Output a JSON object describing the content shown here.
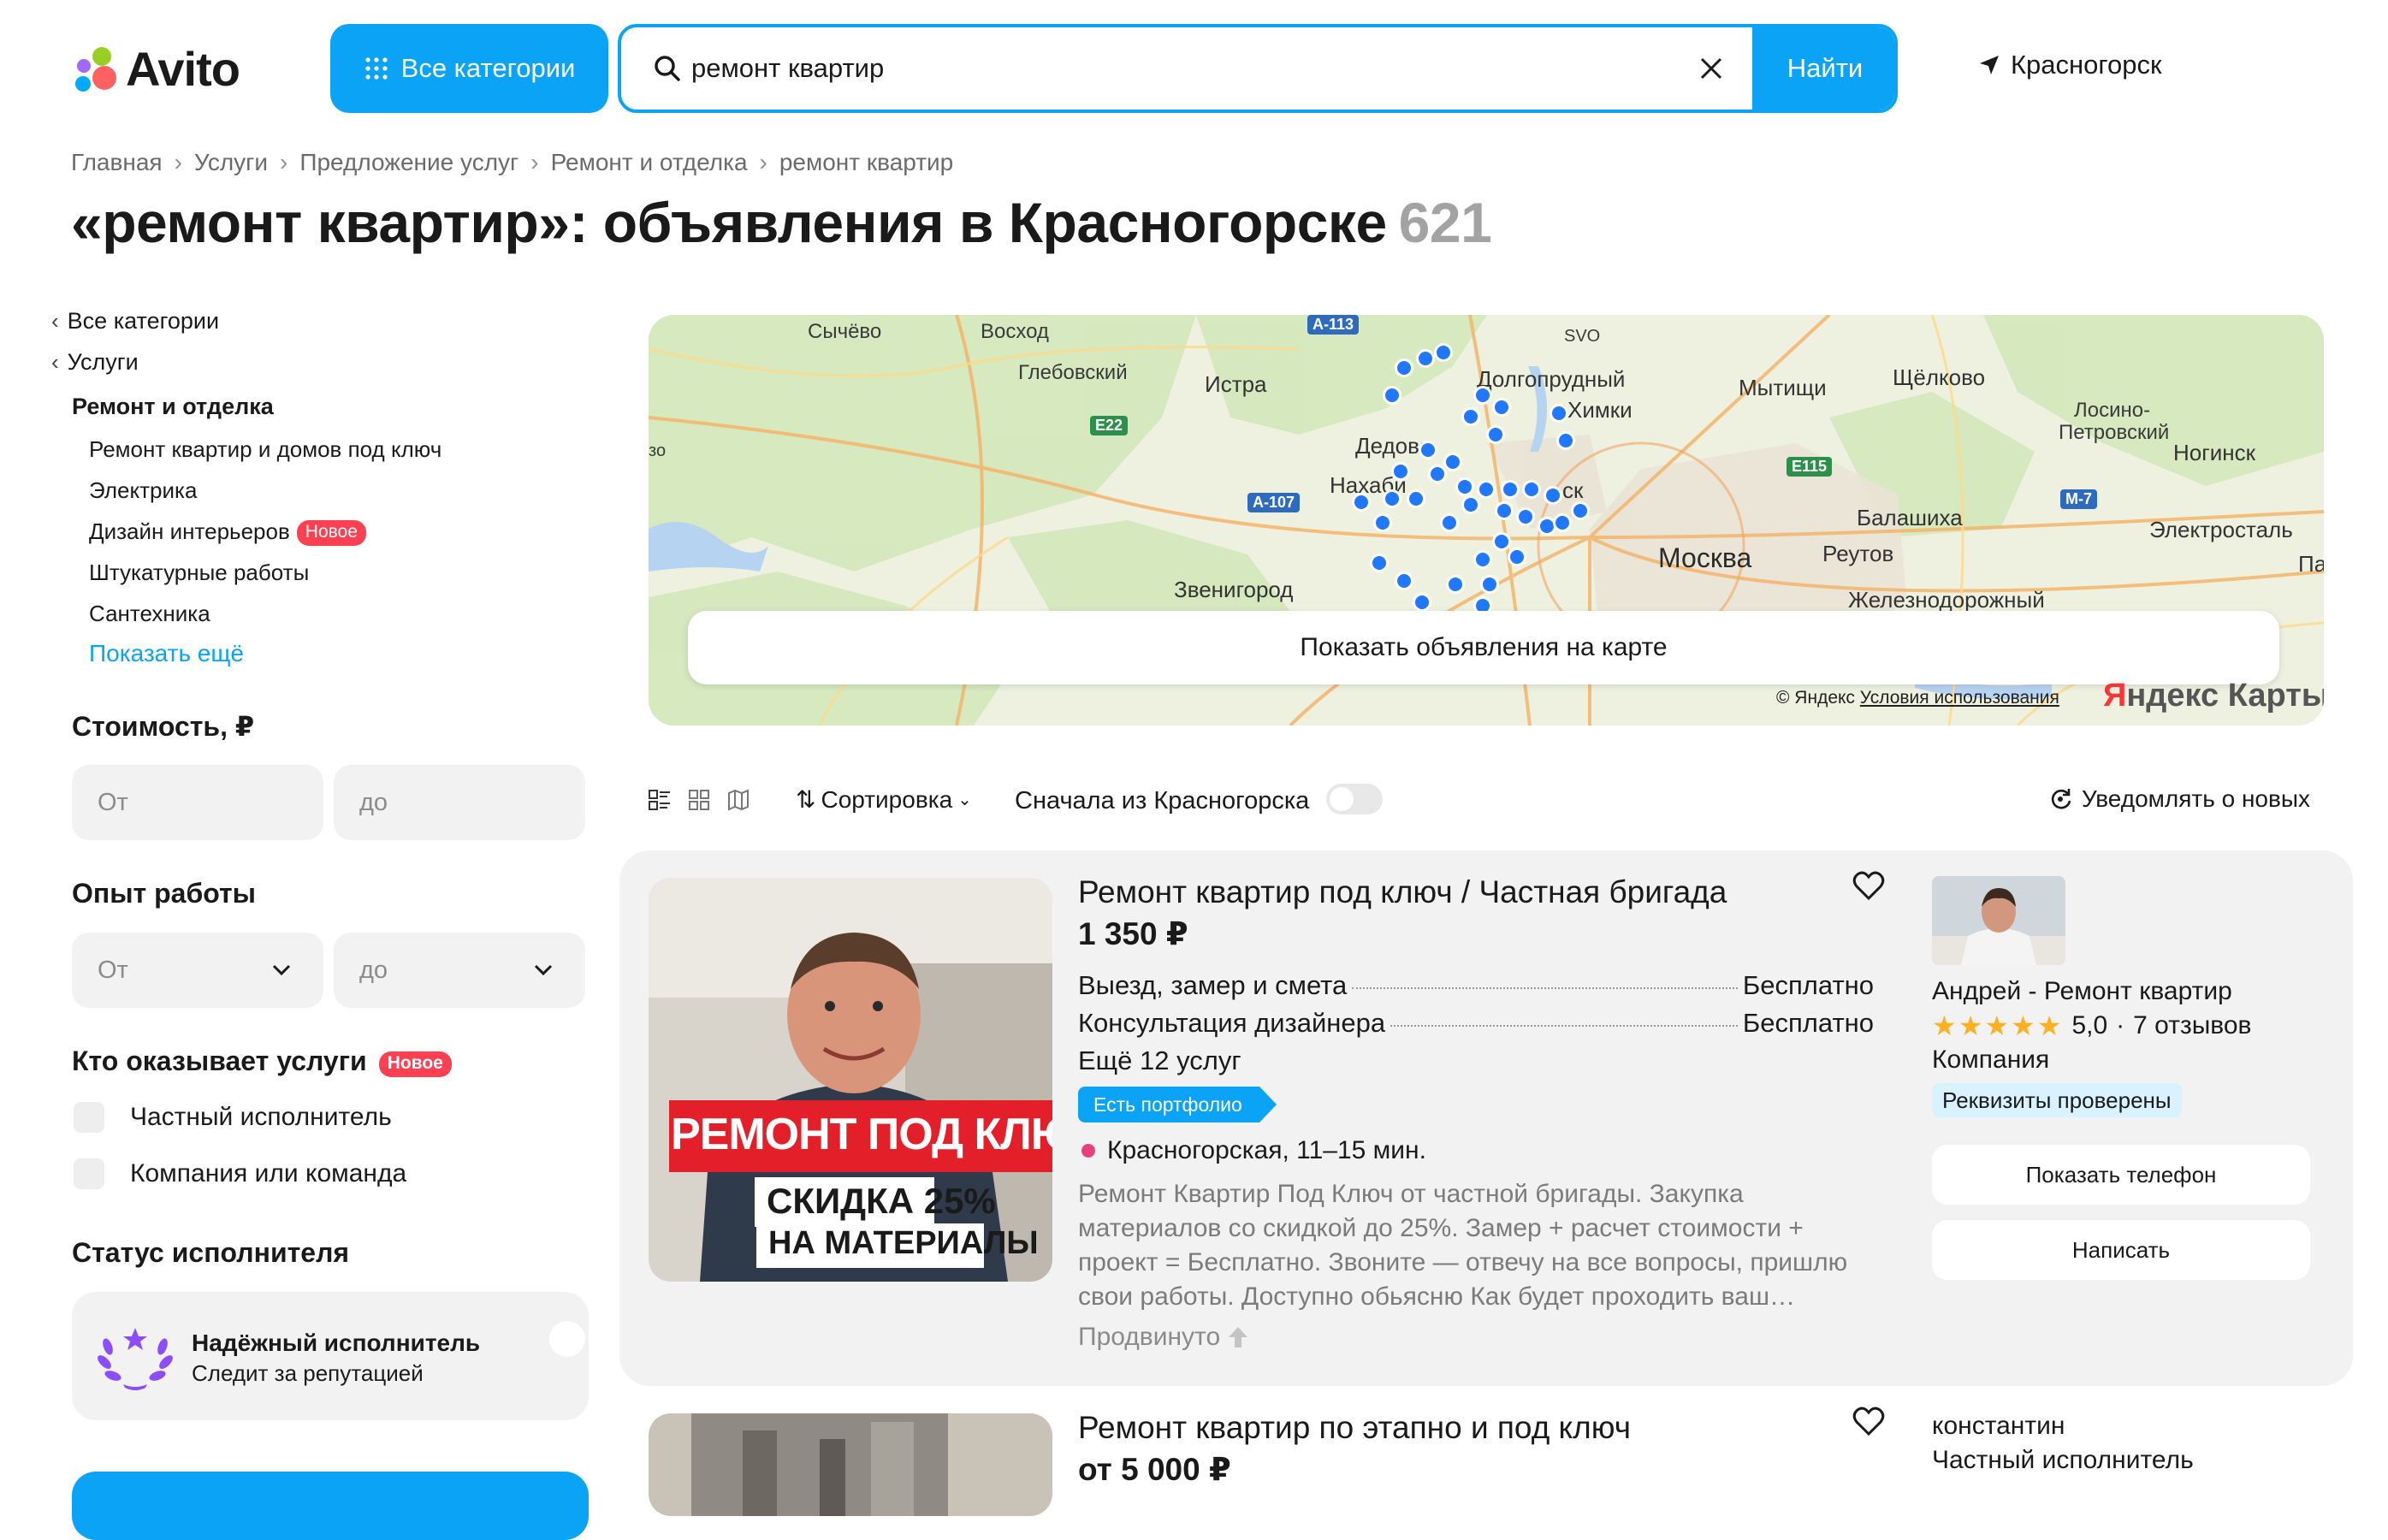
{
  "header": {
    "logo_text": "Avito",
    "all_categories": "Все категории",
    "search_value": "ремонт квартир",
    "search_button": "Найти",
    "location": "Красногорск",
    "accent_color": "#0aa3f5"
  },
  "breadcrumb": [
    "Главная",
    "Услуги",
    "Предложение услуг",
    "Ремонт и отделка",
    "ремонт квартир"
  ],
  "page_title": "«ремонт квартир»: объявления в Красногорске",
  "results_count": "621",
  "sidebar": {
    "back_all": "Все категории",
    "back_services": "Услуги",
    "current_category": "Ремонт и отделка",
    "subcategories": [
      "Ремонт квартир и домов под ключ",
      "Электрика",
      "Дизайн интерьеров",
      "Штукатурные работы",
      "Сантехника"
    ],
    "new_badge": "Новое",
    "show_more": "Показать ещё",
    "price": {
      "title": "Стоимость, ₽",
      "from": "От",
      "to": "до"
    },
    "experience": {
      "title": "Опыт работы",
      "from": "От",
      "to": "до"
    },
    "provider": {
      "title": "Кто оказывает услуги",
      "badge": "Новое",
      "options": [
        "Частный исполнитель",
        "Компания или команда"
      ]
    },
    "status": {
      "title": "Статус исполнителя",
      "reliable_title": "Надёжный исполнитель",
      "reliable_sub": "Следит за репутацией"
    }
  },
  "map": {
    "show_on_map": "Показать объявления на карте",
    "copyright": "© Яндекс",
    "terms": "Условия использования",
    "brand_y": "Я",
    "brand_rest": "ндекс Карты",
    "labels": {
      "sychevo": "Сычёво",
      "voskhod": "Восход",
      "glebovsky": "Глебовский",
      "istra": "Истра",
      "svo": "SVO",
      "dolgoprudny": "Долгопрудный",
      "khimki": "Химки",
      "mytishchi": "Мытищи",
      "shchelkovo": "Щёлково",
      "losino": "Лосино-",
      "petrovsky": "Петровский",
      "noginsk": "Ногинск",
      "dedovsk": "Дедовс",
      "nakhabino": "Нахаби",
      "sk": "ск",
      "moskva": "Москва",
      "reutov": "Реутов",
      "balashikha": "Балашиха",
      "elektrostal": "Электросталь",
      "pav": "Пав",
      "zvenigorod": "Звенигород",
      "zheleznodorozhny": "Железнодорожный",
      "edge": "зо"
    },
    "routes": {
      "a113": "A-113",
      "e22": "E22",
      "a107": "A-107",
      "e115": "E115",
      "m7": "M-7"
    }
  },
  "toolbar": {
    "sort": "Сортировка",
    "krasnogorsk_first": "Сначала из Красногорска",
    "notify": "Уведомлять о новых"
  },
  "listings": [
    {
      "title": "Ремонт квартир под ключ / Частная бригада",
      "price": "1 350 ₽",
      "image_text_1": "РЕМОНТ ПОД КЛЮЧ",
      "image_text_2": "СКИДКА 25%",
      "image_text_3": "НА МАТЕРИАЛЫ",
      "services": [
        {
          "name": "Выезд, замер и смета",
          "price": "Бесплатно"
        },
        {
          "name": "Консультация дизайнера",
          "price": "Бесплатно"
        }
      ],
      "more_services": "Ещё 12 услуг",
      "portfolio_badge": "Есть портфолио",
      "metro": "Красногорская, 11–15 мин.",
      "description": "Ремонт Квартир Под Ключ от частной бригады. Закупка материалов со скидкой до 25%. Замер + расчет стоимости + проект = Бесплатно. Звоните — отвечу на все вопросы, пришлю свои работы. Доступно обьясню Как будет проходить ваш…",
      "promoted": "Продвинуто",
      "seller_name": "Андрей - Ремонт квартир",
      "rating": "5,0",
      "reviews": "7 отзывов",
      "seller_type": "Компания",
      "verified": "Реквизиты проверены",
      "show_phone": "Показать телефон",
      "write": "Написать"
    },
    {
      "title": "Ремонт квартир по этапно и под ключ",
      "price": "от 5 000 ₽",
      "seller_name": "константин",
      "seller_type": "Частный исполнитель"
    }
  ]
}
